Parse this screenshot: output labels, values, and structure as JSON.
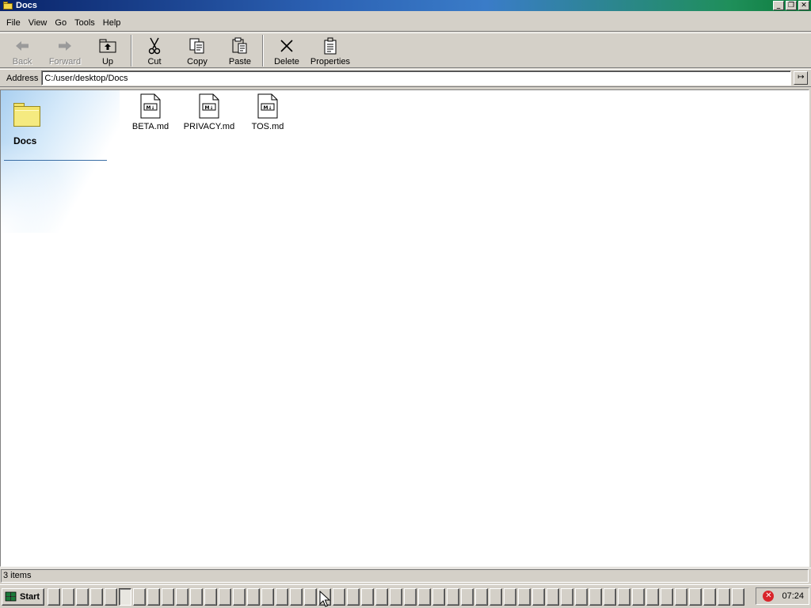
{
  "window": {
    "title": "Docs",
    "controls": {
      "minimize": "_",
      "maximize": "❐",
      "close": "✕"
    }
  },
  "menubar": {
    "items": [
      {
        "label": "File"
      },
      {
        "label": "View"
      },
      {
        "label": "Go"
      },
      {
        "label": "Tools"
      },
      {
        "label": "Help"
      }
    ]
  },
  "toolbar": {
    "back": {
      "label": "Back",
      "icon": "back-arrow-icon",
      "enabled": false
    },
    "forward": {
      "label": "Forward",
      "icon": "forward-arrow-icon",
      "enabled": false
    },
    "up": {
      "label": "Up",
      "icon": "up-folder-icon"
    },
    "cut": {
      "label": "Cut",
      "icon": "scissors-icon"
    },
    "copy": {
      "label": "Copy",
      "icon": "copy-icon"
    },
    "paste": {
      "label": "Paste",
      "icon": "paste-icon"
    },
    "delete": {
      "label": "Delete",
      "icon": "delete-x-icon"
    },
    "properties": {
      "label": "Properties",
      "icon": "properties-icon"
    }
  },
  "address": {
    "label": "Address",
    "value": "C:/user/desktop/Docs",
    "go_icon": "go-arrow-icon"
  },
  "sidebar": {
    "folder_title": "Docs",
    "icon": "folder-icon"
  },
  "files": [
    {
      "name": "BETA.md",
      "icon": "markdown-file-icon"
    },
    {
      "name": "PRIVACY.md",
      "icon": "markdown-file-icon"
    },
    {
      "name": "TOS.md",
      "icon": "markdown-file-icon"
    }
  ],
  "file_badge": "M↓",
  "status": {
    "text": "3 items"
  },
  "taskbar": {
    "start_label": "Start",
    "clock": "07:24",
    "tray_icon": "error-icon",
    "tray_glyph": "✕"
  }
}
